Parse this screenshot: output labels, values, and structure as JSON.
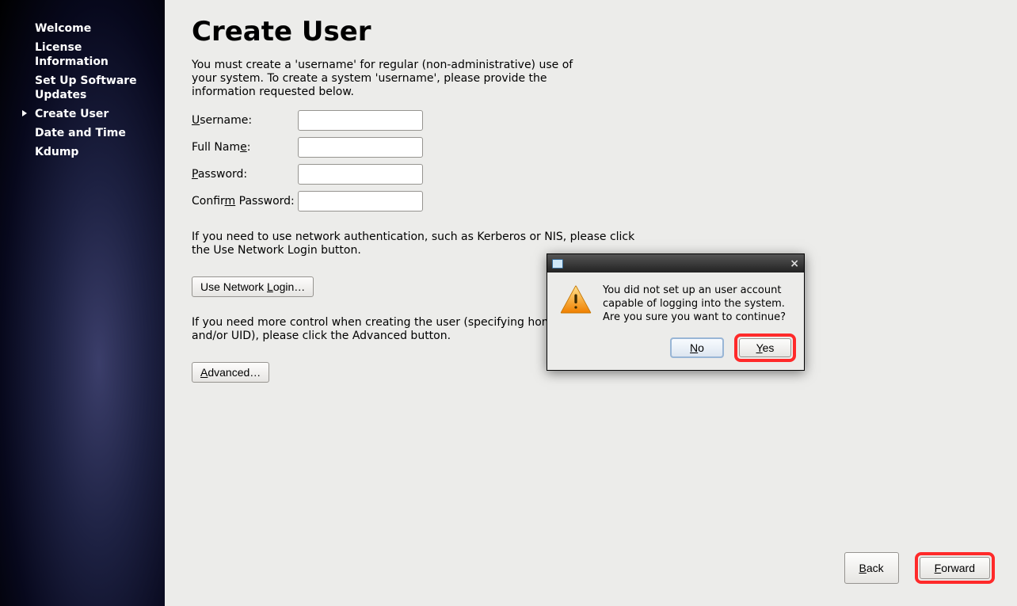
{
  "sidebar": {
    "items": [
      {
        "label": "Welcome"
      },
      {
        "label": "License Information"
      },
      {
        "label": "Set Up Software Updates"
      },
      {
        "label": "Create User"
      },
      {
        "label": "Date and Time"
      },
      {
        "label": "Kdump"
      }
    ],
    "active_index": 3
  },
  "page": {
    "title": "Create User",
    "description": "You must create a 'username' for regular (non-administrative) use of your system.  To create a system 'username', please provide the information requested below.",
    "fields": {
      "username_label": "Username:",
      "username_value": "",
      "fullname_label": "Full Name:",
      "fullname_value": "",
      "password_label": "Password:",
      "password_value": "",
      "confirm_label": "Confirm Password:",
      "confirm_value": ""
    },
    "network_note": "If you need to use network authentication, such as Kerberos or NIS, please click the Use Network Login button.",
    "network_button": "Use Network Login…",
    "advanced_note": "If you need more control when creating the user (specifying home directory, and/or UID), please click the Advanced button.",
    "advanced_button": "Advanced…"
  },
  "footer": {
    "back": "Back",
    "forward": "Forward"
  },
  "dialog": {
    "message": "You did not set up an user account capable of logging into the system. Are you sure you want to continue?",
    "no": "No",
    "yes": "Yes"
  }
}
